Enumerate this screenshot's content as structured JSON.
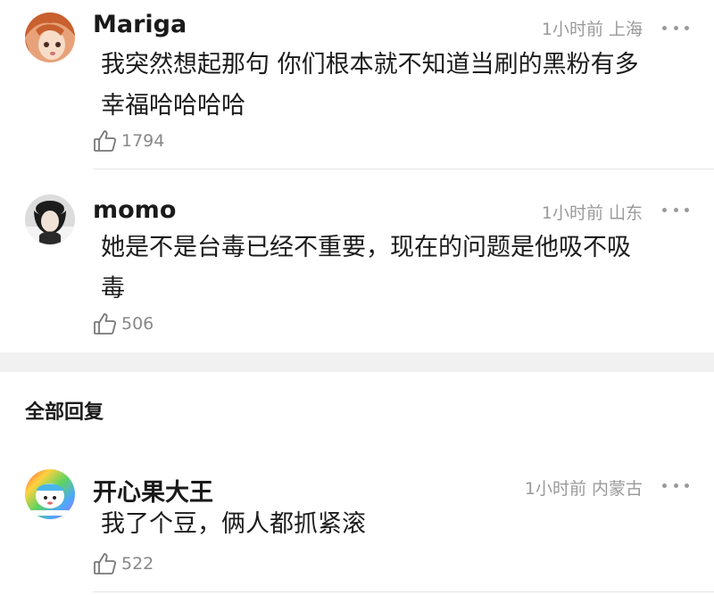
{
  "comments": [
    {
      "username": "Mariga",
      "meta": "1小时前 上海",
      "text_line1": "我突然想起那句 你们根本就不知道当刷的黑粉有多",
      "text_line2": "幸福哈哈哈哈",
      "likes": "1794",
      "avatar_icon": "anime-girl-avatar-icon"
    },
    {
      "username": "momo",
      "meta": "1小时前 山东",
      "text_line1": "她是不是台毒已经不重要，现在的问题是他吸不吸",
      "text_line2": "毒",
      "likes": "506",
      "avatar_icon": "photo-avatar-icon"
    }
  ],
  "section": {
    "title": "全部回复"
  },
  "replies": [
    {
      "username": "开心果大王",
      "meta": "1小时前 内蒙古",
      "text_line1": "我了个豆，俩人都抓紧滚",
      "likes": "522",
      "avatar_icon": "cartoon-sticker-avatar-icon"
    }
  ],
  "colors": {
    "meta_gray": "#9a9a9a",
    "section_bg": "#f1f1f1",
    "divider": "#e6e6e6"
  }
}
